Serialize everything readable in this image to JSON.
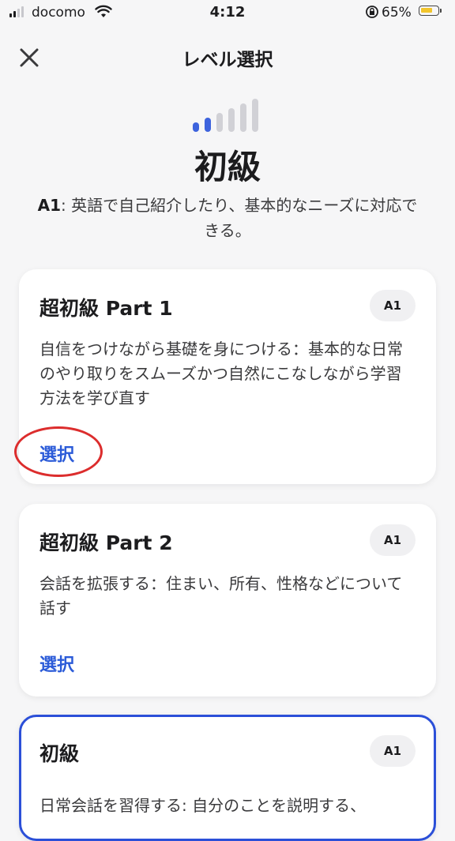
{
  "status_bar": {
    "carrier": "docomo",
    "time": "4:12",
    "battery_percent": "65%",
    "battery_level": 0.65,
    "signal_icon": "signal-bars-icon",
    "wifi_icon": "wifi-icon",
    "rotation_lock_icon": "rotation-lock-icon"
  },
  "header": {
    "title": "レベル選択",
    "close_icon": "close-icon"
  },
  "level": {
    "bars_icon": "level-bars-icon",
    "bars_filled": 2,
    "bars_total": 6,
    "name": "初級",
    "code": "A1",
    "description": ": 英語で自己紹介したり、基本的なニーズに対応できる。"
  },
  "cards": [
    {
      "title": "超初級 Part 1",
      "badge": "A1",
      "description": "自信をつけながら基礎を身につける：基本的な日常のやり取りをスムーズかつ自然にこなしながら学習方法を学び直す",
      "action": "選択"
    },
    {
      "title": "超初級 Part 2",
      "badge": "A1",
      "description": "会話を拡張する：住まい、所有、性格などについて話す",
      "action": "選択"
    },
    {
      "title": "初級",
      "badge": "A1",
      "description": "日常会話を習得する: 自分のことを説明する、"
    }
  ],
  "colors": {
    "accent_blue": "#2b5bd8",
    "selected_border": "#2b4fd8",
    "highlight_ring": "#dc2d2d",
    "battery_fill": "#f2c52c"
  }
}
